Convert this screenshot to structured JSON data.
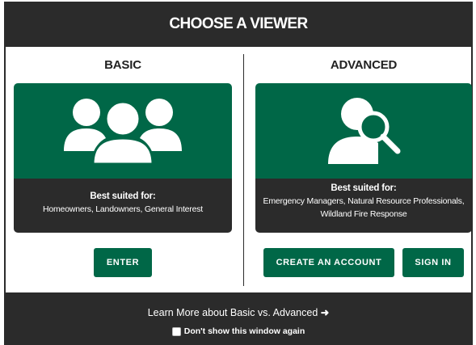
{
  "header": {
    "title": "CHOOSE A VIEWER"
  },
  "basic": {
    "title": "BASIC",
    "icon": "people-group-icon",
    "suited_label": "Best suited for:",
    "suited_desc": "Homeowners, Landowners, General Interest",
    "enter_label": "ENTER"
  },
  "advanced": {
    "title": "ADVANCED",
    "icon": "user-search-icon",
    "suited_label": "Best suited for:",
    "suited_desc_line1": "Emergency Managers, Natural Resource Professionals,",
    "suited_desc_line2": "Wildland Fire Response",
    "create_account_label": "CREATE AN ACCOUNT",
    "sign_in_label": "SIGN IN"
  },
  "footer": {
    "learn_more": "Learn More about Basic vs. Advanced",
    "dont_show": "Don't show this window again",
    "dont_show_checked": false
  },
  "colors": {
    "dark": "#2b2b2b",
    "green": "#006747",
    "white": "#ffffff"
  }
}
